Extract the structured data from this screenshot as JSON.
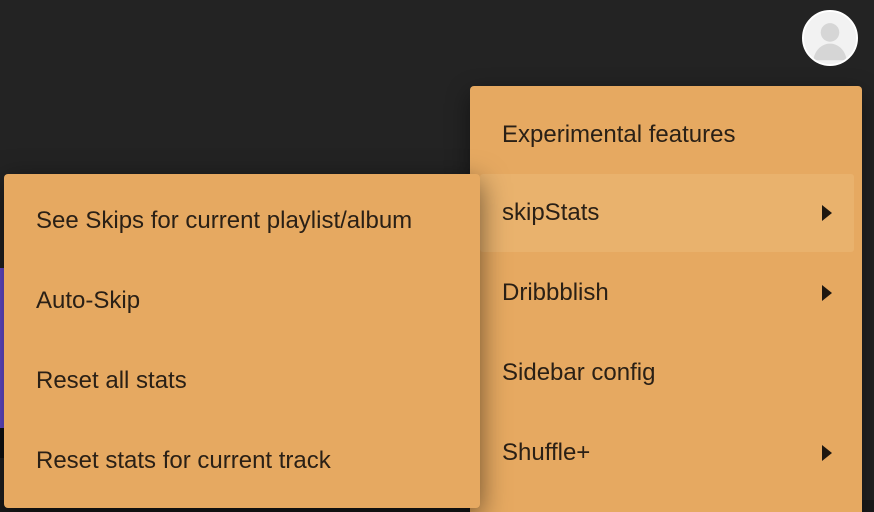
{
  "header": {
    "avatar_icon": "user-avatar-icon"
  },
  "main_menu": {
    "items": [
      {
        "label": "Experimental features",
        "has_submenu": false
      },
      {
        "label": "skipStats",
        "has_submenu": true,
        "active": true
      },
      {
        "label": "Dribbblish",
        "has_submenu": true
      },
      {
        "label": "Sidebar config",
        "has_submenu": false
      },
      {
        "label": "Shuffle+",
        "has_submenu": true
      }
    ]
  },
  "submenu": {
    "items": [
      {
        "label": "See Skips for current playlist/album"
      },
      {
        "label": "Auto-Skip"
      },
      {
        "label": "Reset all stats"
      },
      {
        "label": "Reset stats for current track"
      }
    ]
  },
  "colors": {
    "menu_bg": "#e6a961",
    "menu_active": "#e9b26d",
    "page_bg": "#232323",
    "text": "#2a2016"
  }
}
